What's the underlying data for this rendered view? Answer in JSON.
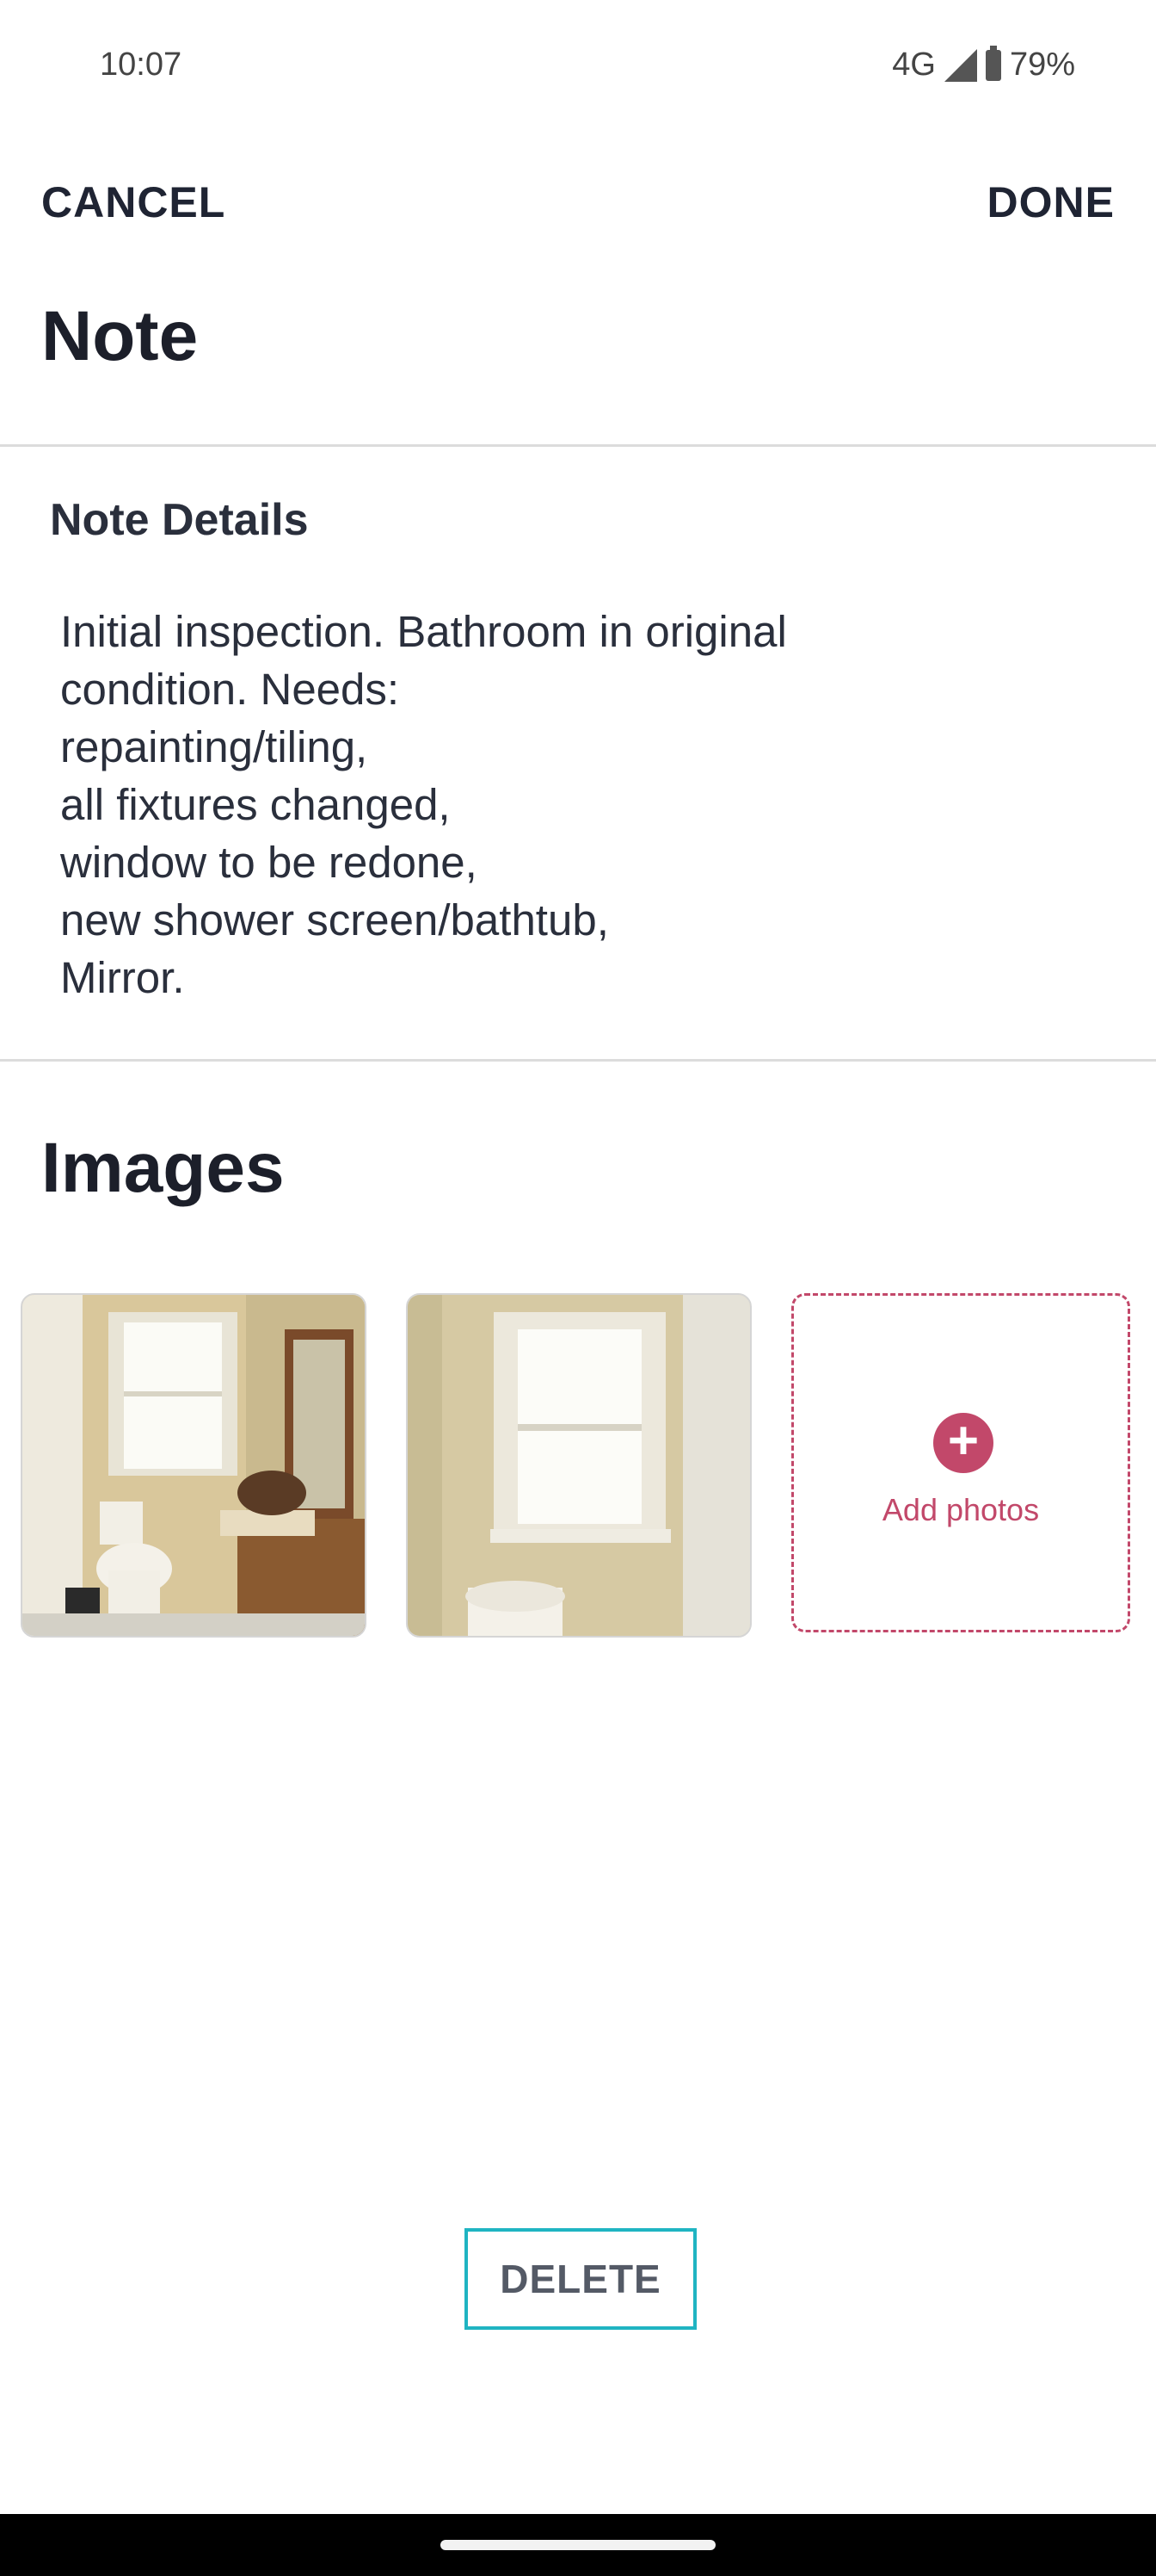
{
  "status_bar": {
    "time": "10:07",
    "network": "4G",
    "battery": "79%"
  },
  "toolbar": {
    "cancel_label": "CANCEL",
    "done_label": "DONE"
  },
  "page": {
    "title": "Note"
  },
  "note_details": {
    "label": "Note Details",
    "text": "Initial inspection. Bathroom in original\ncondition. Needs:\nrepainting/tiling,\nall fixtures changed,\nwindow to be redone,\nnew shower screen/bathtub,\nMirror."
  },
  "images": {
    "title": "Images",
    "add_label": "Add photos"
  },
  "actions": {
    "delete_label": "DELETE"
  },
  "colors": {
    "accent": "#c2486a",
    "delete_border": "#1fb4c2",
    "text": "#1f2433"
  }
}
